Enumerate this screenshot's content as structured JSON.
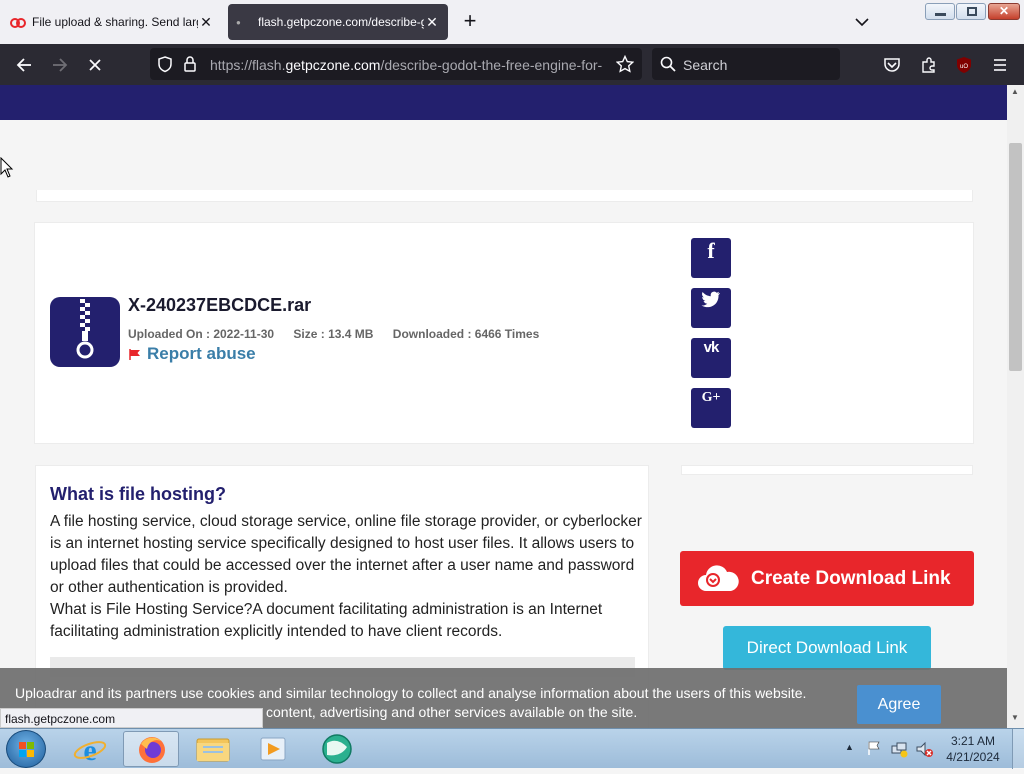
{
  "browser": {
    "tabs": [
      {
        "title": "File upload & sharing. Send large files"
      },
      {
        "title": "flash.getpczone.com/describe-godot-the-free-engine-for-"
      }
    ],
    "url_prefix": "https://flash.",
    "url_domain": "getpczone.com",
    "url_path": "/describe-godot-the-free-engine-for-",
    "search_placeholder": "Search",
    "status_url": "flash.getpczone.com"
  },
  "file": {
    "name": "X-240237EBCDCE.rar",
    "uploaded": "Uploaded On : 2022-11-30",
    "size": "Size : 13.4 MB",
    "downloaded": "Downloaded : 6466 Times",
    "report": "Report abuse"
  },
  "social": {
    "facebook": "f",
    "vk": "vk",
    "gplus": "G+"
  },
  "article": {
    "heading": "What is file hosting?",
    "p1": "A file hosting service, cloud storage service, online file storage provider, or cyberlocker is an internet hosting service specifically designed to host user files. It allows users to upload files that could be accessed over the internet after a user name and password or other authentication is provided.",
    "p2": "What is File Hosting Service?A document facilitating administration is an Internet facilitating administration explicitly intended to have client records."
  },
  "actions": {
    "create_link": "Create Download Link",
    "direct_link": "Direct Download Link"
  },
  "cookie": {
    "line1": "Uploadrar and its partners use cookies and similar technology to collect and analyse information about the users of this website.",
    "line2": "content, advertising and other services available on the site.",
    "agree": "Agree"
  },
  "taskbar": {
    "time": "3:21 AM",
    "date": "4/21/2024"
  },
  "colors": {
    "brand_navy": "#23206e",
    "create_red": "#e8262b",
    "direct_blue": "#34b7da",
    "agree_blue": "#4a90d0",
    "report_blue": "#3a7ea8"
  }
}
